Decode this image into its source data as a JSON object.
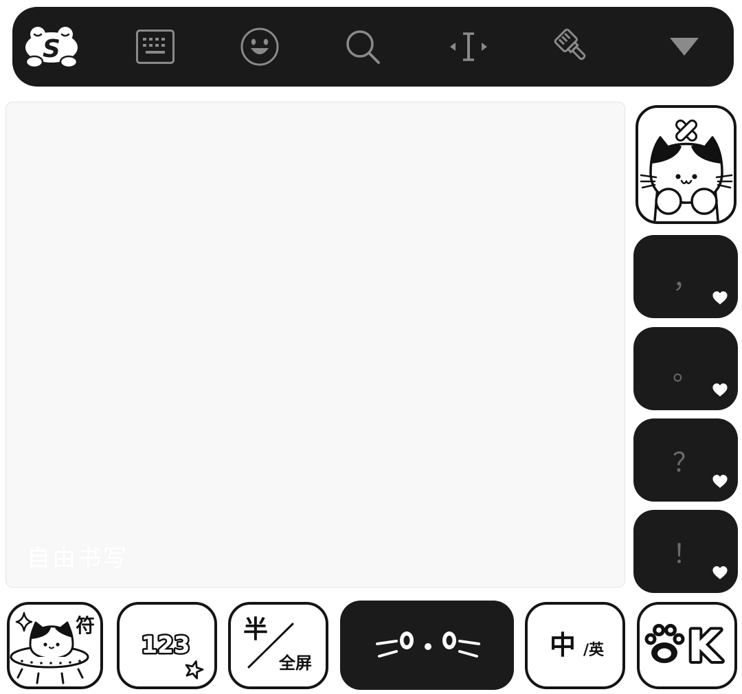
{
  "toolbar": {
    "logo_letter": "S",
    "icons": {
      "logo": "sogou-frog-logo-icon",
      "keyboard": "keyboard-icon",
      "emoji": "smiley-icon",
      "search": "search-icon",
      "cursor": "cursor-move-icon",
      "clean": "brush-icon",
      "hide": "triangle-down-icon"
    }
  },
  "handwriting_pad": {
    "watermark": "自由书写"
  },
  "side_keys": {
    "delete_icon": "cat-delete-icon",
    "punctuation": [
      "，",
      "。",
      "？",
      "！"
    ],
    "heart_icon": "heart-icon"
  },
  "bottom_row": {
    "symbols": {
      "label": "符",
      "icon": "cat-ufo-icon"
    },
    "numbers": {
      "label": "123",
      "icon": "star-icon"
    },
    "half_full": {
      "top": "半",
      "bottom": "全屏"
    },
    "space": {
      "icon": "cat-face-icon"
    },
    "lang_switch": {
      "main": "中",
      "sub": "/英"
    },
    "enter": {
      "label": "K",
      "icon": "paw-icon"
    }
  },
  "colors": {
    "toolbar_bg": "#1a1a1a",
    "icon_gray": "#8a8a8a",
    "pad_bg": "#f8f8f8",
    "key_black": "#1b1b1b",
    "key_white": "#ffffff",
    "outline": "#141414",
    "punct_gray": "#6b6b6b"
  }
}
